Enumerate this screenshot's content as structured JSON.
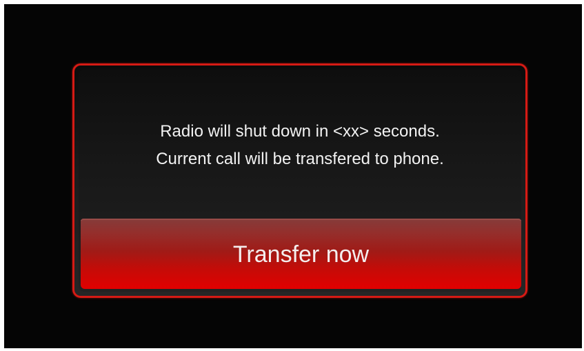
{
  "dialog": {
    "message_line_1": "Radio will shut down in <xx> seconds.",
    "message_line_2": "Current call will be transfered to phone.",
    "transfer_button_label": "Transfer now"
  },
  "colors": {
    "background": "#050505",
    "accent_border": "#d61a14",
    "button_red": "#e20000",
    "text": "#f2f2f2"
  }
}
